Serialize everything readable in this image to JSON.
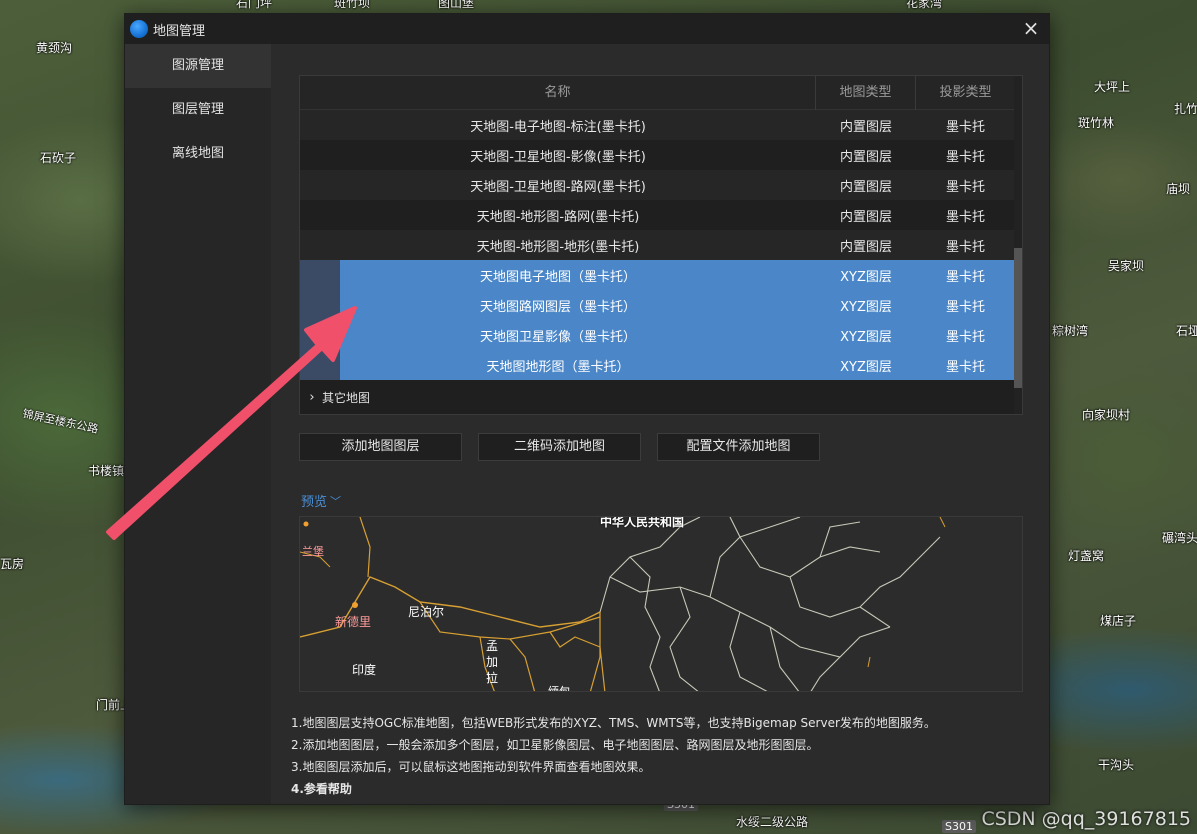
{
  "background": {
    "labels": [
      "石门坪",
      "斑竹坝",
      "图山堡",
      "花家湾",
      "黄颈沟",
      "石砍子",
      "锦屏至楼东公路",
      "书楼镇",
      "瓦房",
      "门前上",
      "大坪上",
      "斑竹林",
      "扎竹",
      "庙坝",
      "吴家坝",
      "粽树湾",
      "石垭",
      "向家坝村",
      "碾湾头",
      "灯盏窝",
      "煤店子",
      "干沟头",
      "水绥二级公路"
    ],
    "road_badges": [
      "S301",
      "S301"
    ],
    "watermark": "CSDN @qq_39167815"
  },
  "dialog": {
    "title": "地图管理",
    "close_icon": "×"
  },
  "sidebar": {
    "items": [
      {
        "label": "图源管理"
      },
      {
        "label": "图层管理"
      },
      {
        "label": "离线地图"
      }
    ]
  },
  "table": {
    "headers": {
      "name": "名称",
      "map_type": "地图类型",
      "projection": "投影类型"
    },
    "rows": [
      {
        "name": "天地图-电子地图-标注(墨卡托)",
        "map_type": "内置图层",
        "projection": "墨卡托"
      },
      {
        "name": "天地图-卫星地图-影像(墨卡托)",
        "map_type": "内置图层",
        "projection": "墨卡托"
      },
      {
        "name": "天地图-卫星地图-路网(墨卡托)",
        "map_type": "内置图层",
        "projection": "墨卡托"
      },
      {
        "name": "天地图-地形图-路网(墨卡托)",
        "map_type": "内置图层",
        "projection": "墨卡托"
      },
      {
        "name": "天地图-地形图-地形(墨卡托)",
        "map_type": "内置图层",
        "projection": "墨卡托"
      },
      {
        "name": "天地图电子地图（墨卡托）",
        "map_type": "XYZ图层",
        "projection": "墨卡托"
      },
      {
        "name": "天地图路网图层（墨卡托）",
        "map_type": "XYZ图层",
        "projection": "墨卡托"
      },
      {
        "name": "天地图卫星影像（墨卡托）",
        "map_type": "XYZ图层",
        "projection": "墨卡托"
      },
      {
        "name": "天地图地形图（墨卡托）",
        "map_type": "XYZ图层",
        "projection": "墨卡托"
      }
    ],
    "selected_rows": [
      5,
      6,
      7,
      8
    ],
    "group_label": "其它地图"
  },
  "buttons": {
    "add_layer": "添加地图图层",
    "qr_add": "二维码添加地图",
    "config_add": "配置文件添加地图"
  },
  "preview": {
    "toggle_label": "预览",
    "map_labels": {
      "china": "中华人民共和国",
      "lanzhou": "兰堡",
      "newdelhi": "新德里",
      "nepal": "尼泊尔",
      "india": "印度",
      "bangla1": "孟",
      "bangla2": "加",
      "bangla3": "拉",
      "bottom": "缅甸"
    }
  },
  "help": {
    "line1": "1.地图图层支持OGC标准地图，包括WEB形式发布的XYZ、TMS、WMTS等，也支持Bigemap Server发布的地图服务。",
    "line2": "2.添加地图图层，一般会添加多个图层，如卫星影像图层、电子地图图层、路网图层及地形图图层。",
    "line3": "3.地图图层添加后，可以鼠标这地图拖动到软件界面查看地图效果。",
    "line4": "4.参看帮助"
  },
  "colors": {
    "accent": "#4a86c8",
    "link": "#4a8fd8",
    "arrow": "#f0506a"
  }
}
